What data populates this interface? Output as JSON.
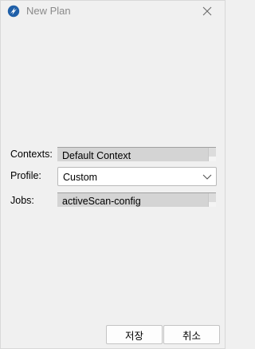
{
  "window": {
    "title": "New Plan"
  },
  "icons": {
    "app": "zap-app-icon",
    "close": "close-icon",
    "dropdown": "chevron-down-icon"
  },
  "form": {
    "contexts": {
      "label": "Contexts:",
      "value": "Default Context"
    },
    "profile": {
      "label": "Profile:",
      "value": "Custom"
    },
    "jobs": {
      "label": "Jobs:",
      "value": "activeScan-config"
    }
  },
  "buttons": {
    "save": "저장",
    "cancel": "취소"
  },
  "colors": {
    "window_bg": "#f0f0f0",
    "readonly_field_bg": "#d4d4d4",
    "title_text": "#8a8a8a",
    "app_icon_blue": "#1f5fa8"
  }
}
